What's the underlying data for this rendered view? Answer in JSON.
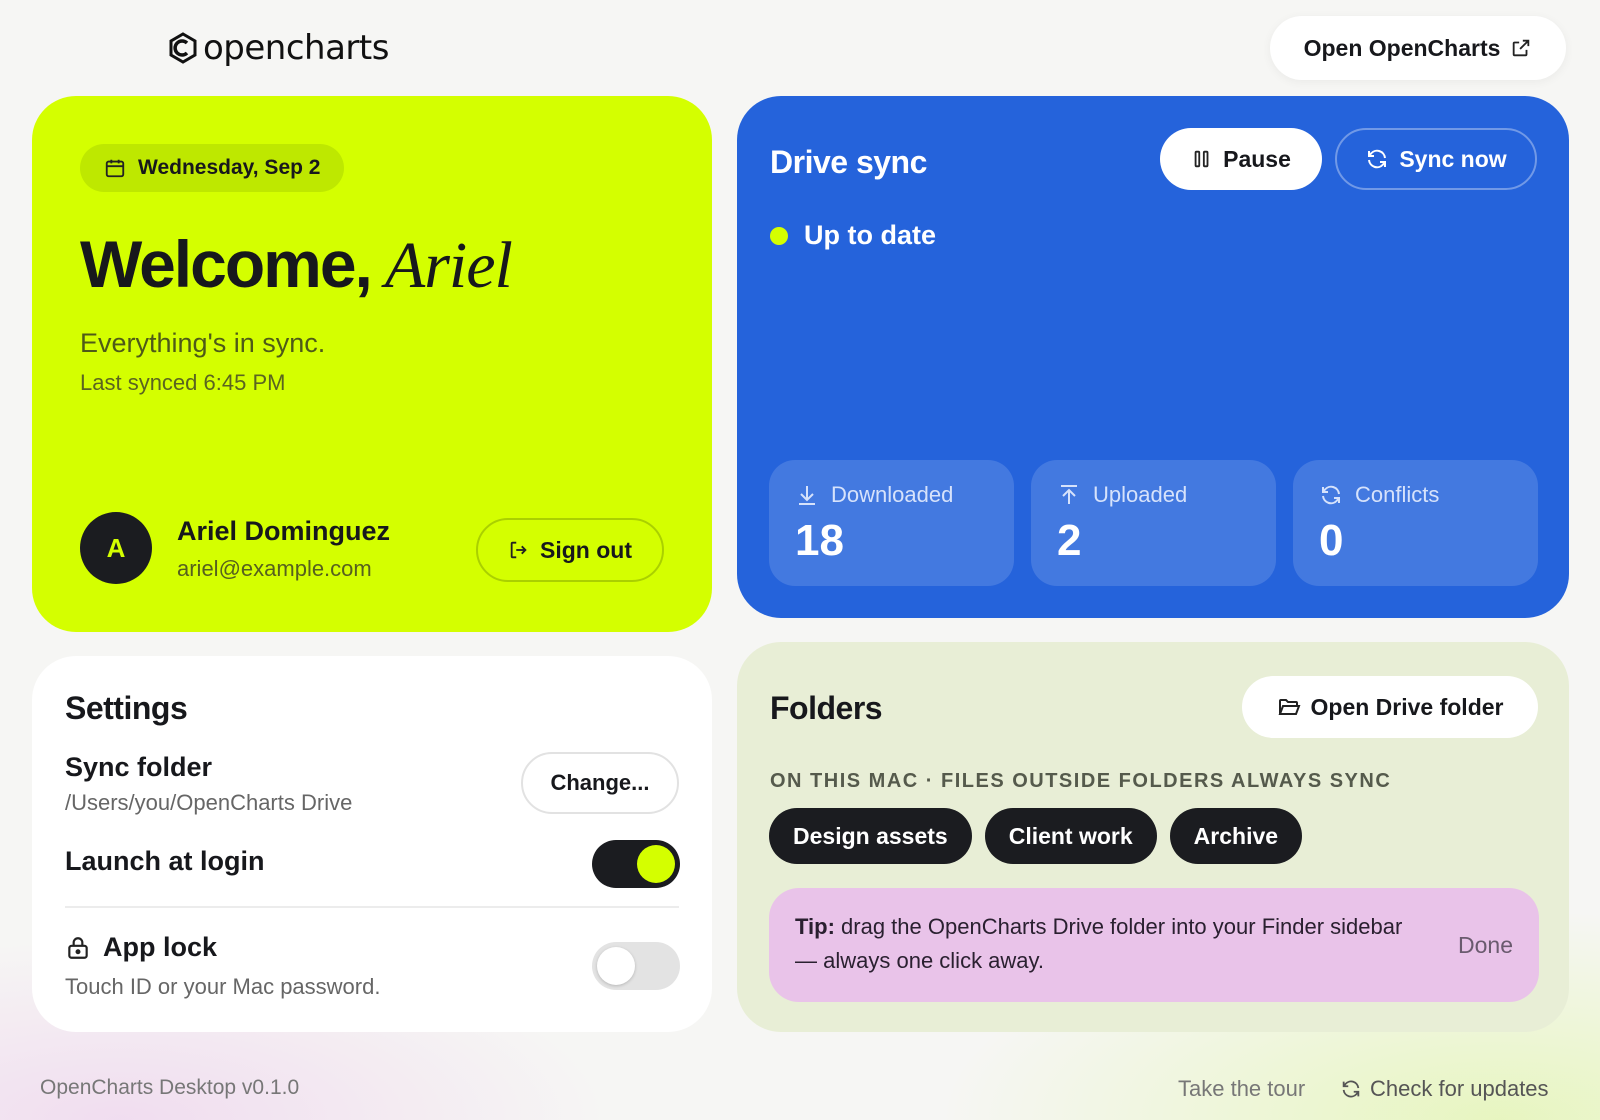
{
  "app": {
    "logo_text": "opencharts",
    "open_button": "Open OpenCharts"
  },
  "welcome": {
    "date": "Wednesday, Sep 2",
    "greeting": "Welcome,",
    "first_name": "Ariel",
    "subtitle": "Everything's in sync.",
    "last_synced": "Last synced 6:45 PM",
    "avatar_initial": "A",
    "user_name": "Ariel Dominguez",
    "user_email": "ariel@example.com",
    "sign_out": "Sign out"
  },
  "drive": {
    "title": "Drive sync",
    "pause": "Pause",
    "sync_now": "Sync now",
    "status": "Up to date",
    "status_color": "#d4ff00",
    "stats": [
      {
        "label": "Downloaded",
        "value": "18",
        "icon": "download-icon"
      },
      {
        "label": "Uploaded",
        "value": "2",
        "icon": "upload-icon"
      },
      {
        "label": "Conflicts",
        "value": "0",
        "icon": "refresh-icon"
      }
    ]
  },
  "settings": {
    "title": "Settings",
    "sync_folder_label": "Sync folder",
    "sync_folder_path": "/Users/you/OpenCharts Drive",
    "change": "Change...",
    "launch_label": "Launch at login",
    "launch_on": true,
    "lock_label": "App lock",
    "lock_sub": "Touch ID or your Mac password.",
    "lock_on": false
  },
  "folders": {
    "title": "Folders",
    "open_folder": "Open Drive folder",
    "caption": "ON THIS MAC · FILES OUTSIDE FOLDERS ALWAYS SYNC",
    "chips": [
      "Design assets",
      "Client work",
      "Archive"
    ],
    "tip_prefix": "Tip:",
    "tip_text": " drag the OpenCharts Drive folder into your Finder sidebar — always one click away.",
    "tip_done": "Done"
  },
  "footer": {
    "version": "OpenCharts Desktop v0.1.0",
    "tour": "Take the tour",
    "updates": "Check for updates"
  },
  "colors": {
    "lime": "#d4ff00",
    "blue": "#2563db",
    "dark": "#1b1c20",
    "tip_pink": "#e9c3e9",
    "folders_bg": "#e8eed6"
  }
}
